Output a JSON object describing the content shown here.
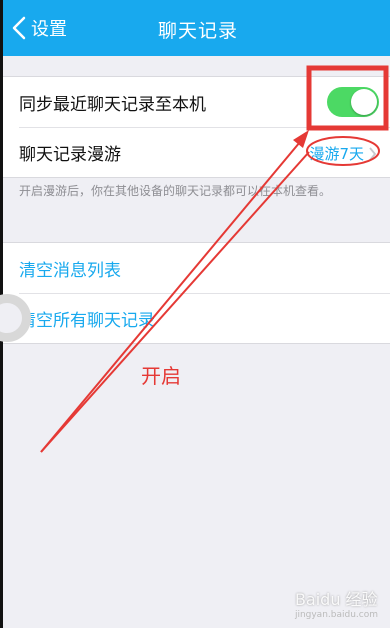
{
  "navbar": {
    "back_label": "设置",
    "title": "聊天记录",
    "back_icon": "chevron-left-icon"
  },
  "settings": {
    "sync_label": "同步最近聊天记录至本机",
    "sync_enabled": true,
    "roam_label": "聊天记录漫游",
    "roam_value": "漫游7天",
    "roam_icon": "chevron-right-icon",
    "hint": "开启漫游后，你在其他设备的聊天记录都可以在本机查看。"
  },
  "actions": {
    "clear_list": "清空消息列表",
    "clear_all": "清空所有聊天记录"
  },
  "annotation": {
    "label": "开启",
    "color": "#e53935"
  },
  "watermark": {
    "text": "Baidu 经验",
    "url": "jingyan.baidu.com"
  },
  "colors": {
    "accent": "#18a9ee",
    "toggle_on": "#4cd964"
  }
}
